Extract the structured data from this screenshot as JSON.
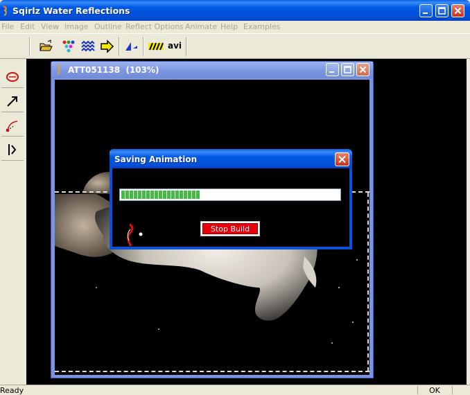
{
  "app": {
    "title": "Sqirlz Water Reflections",
    "icon": "squirrel-icon"
  },
  "menu": {
    "items": [
      "File",
      "Edit",
      "View",
      "Image",
      "Outline",
      "Reflect Options",
      "Animate",
      "Help",
      "Examples"
    ]
  },
  "toolbar": {
    "avi_label": "avi",
    "icons": [
      "open-folder-icon",
      "color-dots-icon",
      "waves-icon",
      "arrow-right-icon",
      "triangle-icon",
      "ripple-icon"
    ]
  },
  "tools": {
    "icons": [
      "ellipse-tool-icon",
      "arrow-tool-icon",
      "curve-tool-icon",
      "split-tool-icon"
    ]
  },
  "child_window": {
    "title": "ATT051138",
    "zoom": "(103%)"
  },
  "dialog": {
    "title": "Saving Animation",
    "progress": 0.37,
    "progress_segments": 20,
    "stop_label": "Stop Build",
    "progress_color": "#3fbf3f"
  },
  "status": {
    "left": "Ready",
    "right": "OK"
  },
  "colors": {
    "titlebar": "#0058e6",
    "child_titlebar": "#7e98e2",
    "stop_button": "#e8000a",
    "workspace": "#000000"
  }
}
